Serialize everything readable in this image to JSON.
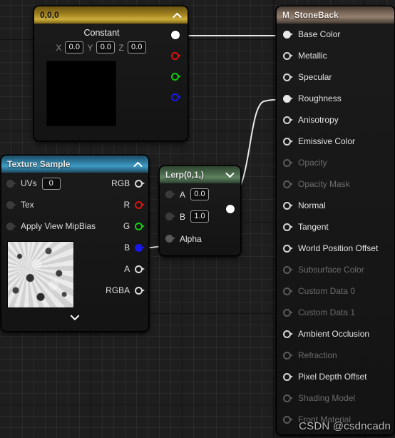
{
  "graph": {
    "watermark": "CSDN @csdncadn"
  },
  "nodes": {
    "constant": {
      "title": "0,0,0",
      "collapse_icon": "chevron-up-icon",
      "label": "Constant",
      "x_label": "X",
      "x_value": "0.0",
      "y_label": "Y",
      "y_value": "0.0",
      "z_label": "Z",
      "z_value": "0.0",
      "outputs": [
        {
          "name": "rgb",
          "color": "white",
          "filled": true
        },
        {
          "name": "r",
          "color": "red",
          "filled": false
        },
        {
          "name": "g",
          "color": "green",
          "filled": false
        },
        {
          "name": "b",
          "color": "blue",
          "filled": false
        }
      ]
    },
    "texture_sample": {
      "title": "Texture Sample",
      "collapse_icon": "chevron-up-icon",
      "inputs": [
        {
          "label": "UVs",
          "value": "0"
        },
        {
          "label": "Tex",
          "value": ""
        },
        {
          "label": "Apply View MipBias",
          "value": ""
        }
      ],
      "outputs": [
        {
          "label": "RGB",
          "color": "white",
          "filled": false
        },
        {
          "label": "R",
          "color": "red",
          "filled": false
        },
        {
          "label": "G",
          "color": "green",
          "filled": false
        },
        {
          "label": "B",
          "color": "blue",
          "filled": true
        },
        {
          "label": "A",
          "color": "white",
          "filled": false
        },
        {
          "label": "RGBA",
          "color": "white",
          "filled": false
        }
      ],
      "expand_icon": "chevron-down-icon"
    },
    "lerp": {
      "title": "Lerp(0,1,)",
      "collapse_icon": "chevron-down-icon",
      "inputs": [
        {
          "label": "A",
          "value": "0.0"
        },
        {
          "label": "B",
          "value": "1.0"
        },
        {
          "label": "Alpha",
          "value": ""
        }
      ]
    },
    "material": {
      "title": "M_StoneBack",
      "inputs": [
        {
          "label": "Base Color",
          "connected": true,
          "enabled": true
        },
        {
          "label": "Metallic",
          "connected": false,
          "enabled": true
        },
        {
          "label": "Specular",
          "connected": false,
          "enabled": true
        },
        {
          "label": "Roughness",
          "connected": true,
          "enabled": true
        },
        {
          "label": "Anisotropy",
          "connected": false,
          "enabled": true
        },
        {
          "label": "Emissive Color",
          "connected": false,
          "enabled": true
        },
        {
          "label": "Opacity",
          "connected": false,
          "enabled": false
        },
        {
          "label": "Opacity Mask",
          "connected": false,
          "enabled": false
        },
        {
          "label": "Normal",
          "connected": false,
          "enabled": true
        },
        {
          "label": "Tangent",
          "connected": false,
          "enabled": true
        },
        {
          "label": "World Position Offset",
          "connected": false,
          "enabled": true
        },
        {
          "label": "Subsurface Color",
          "connected": false,
          "enabled": false
        },
        {
          "label": "Custom Data 0",
          "connected": false,
          "enabled": false
        },
        {
          "label": "Custom Data 1",
          "connected": false,
          "enabled": false
        },
        {
          "label": "Ambient Occlusion",
          "connected": false,
          "enabled": true
        },
        {
          "label": "Refraction",
          "connected": false,
          "enabled": false
        },
        {
          "label": "Pixel Depth Offset",
          "connected": false,
          "enabled": true
        },
        {
          "label": "Shading Model",
          "connected": false,
          "enabled": false
        },
        {
          "label": "Front Material",
          "connected": false,
          "enabled": false
        }
      ]
    }
  },
  "connections": [
    {
      "from": "constant.rgb",
      "to": "material.base_color"
    },
    {
      "from": "lerp.output",
      "to": "material.roughness"
    },
    {
      "from": "texture_sample.b",
      "to": "lerp.alpha"
    }
  ],
  "colors": {
    "wire": "#e8e8e8",
    "red": "#e01010",
    "green": "#12cc12",
    "blue": "#1818ee",
    "constant_title": "#9b7d1d",
    "texture_title": "#2f7fa4",
    "lerp_title": "#49684a",
    "material_title": "#7d6a5c"
  }
}
